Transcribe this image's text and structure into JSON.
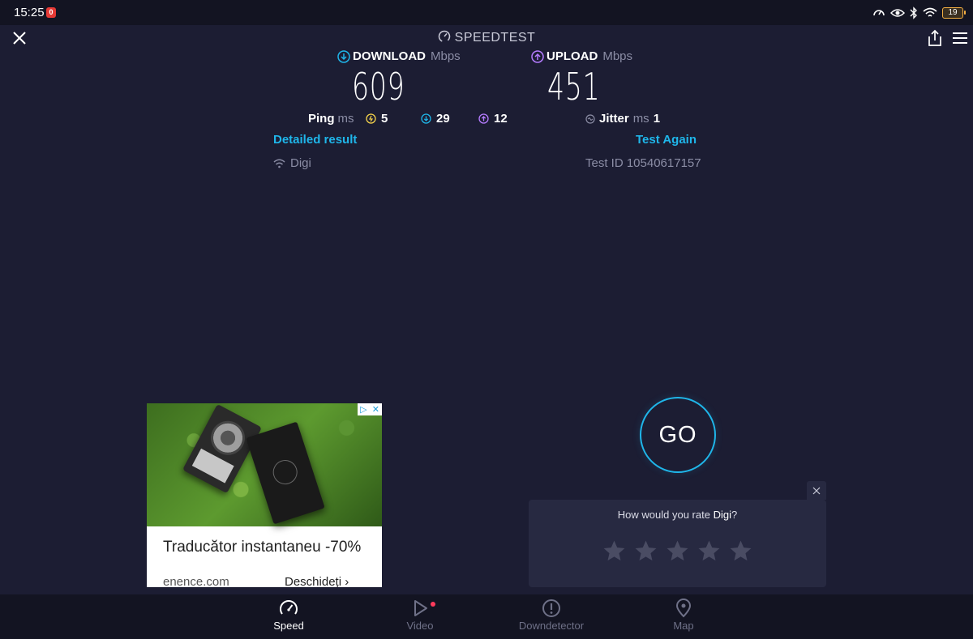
{
  "status_bar": {
    "time": "15:25",
    "notif_badge": "0",
    "battery": "19"
  },
  "header": {
    "title": "SPEEDTEST"
  },
  "download": {
    "label": "DOWNLOAD",
    "unit": "Mbps",
    "value": "609",
    "icon_color": "#1fb6ea"
  },
  "upload": {
    "label": "UPLOAD",
    "unit": "Mbps",
    "value": "451",
    "icon_color": "#b57cff"
  },
  "ping": {
    "label": "Ping",
    "unit": "ms",
    "idle": "5",
    "download": "29",
    "upload": "12"
  },
  "jitter": {
    "label": "Jitter",
    "unit": "ms",
    "value": "1"
  },
  "links": {
    "detailed": "Detailed result",
    "test_again": "Test Again"
  },
  "provider": {
    "name": "Digi"
  },
  "test_id": "Test ID 10540617157",
  "ad": {
    "headline": "Traducător instantaneu -70%",
    "domain": "enence.com",
    "cta": "Deschideți"
  },
  "go_label": "GO",
  "rating": {
    "question_prefix": "How would you rate ",
    "provider": "Digi",
    "question_suffix": "?",
    "stars": 5
  },
  "nav": [
    {
      "label": "Speed",
      "icon": "speed-gauge-icon",
      "active": true
    },
    {
      "label": "Video",
      "icon": "play-icon",
      "active": false
    },
    {
      "label": "Downdetector",
      "icon": "alert-icon",
      "active": false
    },
    {
      "label": "Map",
      "icon": "location-pin-icon",
      "active": false
    }
  ],
  "colors": {
    "background": "#1c1d33",
    "accent": "#1fb6ea",
    "upload_accent": "#b57cff",
    "ping_idle": "#f5d34b",
    "muted": "#8b8da5"
  }
}
